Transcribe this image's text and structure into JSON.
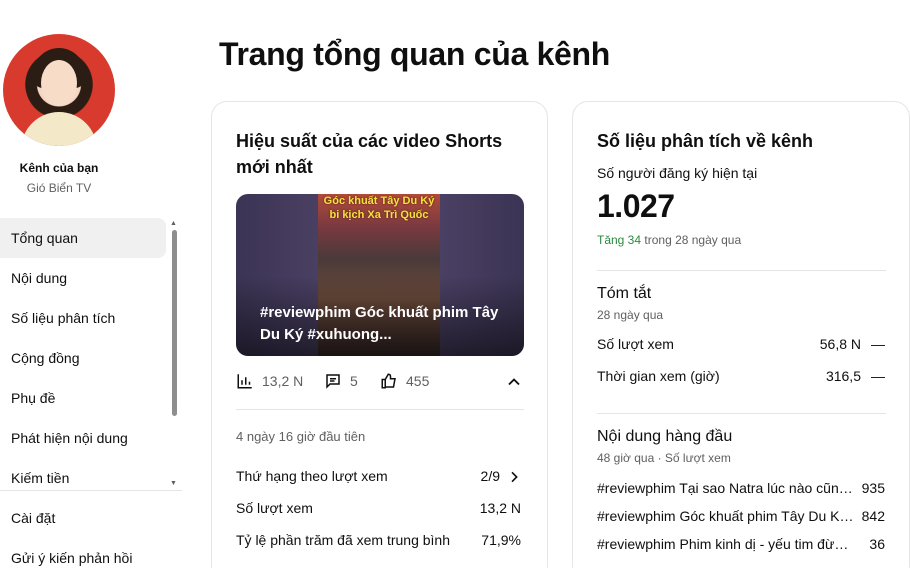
{
  "sidebar": {
    "channel_label": "Kênh của bạn",
    "channel_name": "Gió Biển TV",
    "items": [
      {
        "label": "Tổng quan",
        "active": true
      },
      {
        "label": "Nội dung"
      },
      {
        "label": "Số liệu phân tích"
      },
      {
        "label": "Cộng đồng"
      },
      {
        "label": "Phụ đề"
      },
      {
        "label": "Phát hiện nội dung"
      },
      {
        "label": "Kiếm tiền"
      }
    ],
    "bottom_items": [
      {
        "label": "Cài đặt"
      },
      {
        "label": "Gửi ý kiến phản hồi"
      }
    ]
  },
  "page": {
    "title": "Trang tổng quan của kênh"
  },
  "shorts_card": {
    "title": "Hiệu suất của các video Shorts mới nhất",
    "thumbnail_overlay_text": "Góc khuất Tây Du Ký bi kịch Xa Trì Quốc",
    "video_caption": "#reviewphim Góc khuất phim Tây Du Ký #xuhuong...",
    "views": "13,2 N",
    "comments": "5",
    "likes": "455",
    "period": "4 ngày 16 giờ đầu tiên",
    "metrics": [
      {
        "label": "Thứ hạng theo lượt xem",
        "value": "2/9"
      },
      {
        "label": "Số lượt xem",
        "value": "13,2 N"
      },
      {
        "label": "Tỷ lệ phần trăm đã xem trung bình",
        "value": "71,9%"
      }
    ]
  },
  "analytics_card": {
    "title": "Số liệu phân tích về kênh",
    "subscribers_label": "Số người đăng ký hiện tại",
    "subscribers_value": "1.027",
    "growth_up": "Tăng 34",
    "growth_period": "trong 28 ngày qua",
    "summary_title": "Tóm tắt",
    "summary_period": "28 ngày qua",
    "summary_rows": [
      {
        "label": "Số lượt xem",
        "value": "56,8 N",
        "trend": "—"
      },
      {
        "label": "Thời gian xem (giờ)",
        "value": "316,5",
        "trend": "—"
      }
    ],
    "top_content_title": "Nội dung hàng đầu",
    "top_content_meta": "48 giờ qua · Số lượt xem",
    "top_content": [
      {
        "title": "#reviewphim Tại sao Natra lúc nào cũng...",
        "views": "935"
      },
      {
        "title": "#reviewphim Góc khuất phim Tây Du Ký...",
        "views": "842"
      },
      {
        "title": "#reviewphim Phim kinh dị - yếu tim đừng...",
        "views": "36"
      }
    ]
  }
}
